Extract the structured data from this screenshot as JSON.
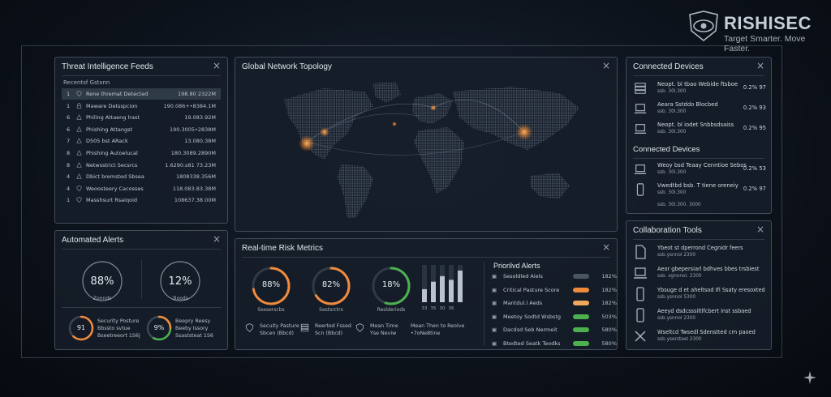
{
  "brand": {
    "name": "RISHISEC",
    "tagline": "Target Smarter. Move Faster."
  },
  "threat_feeds": {
    "title": "Threat Intelligence Feeds",
    "close": "×",
    "subtitle": "Recentsf Gstxnn",
    "rows": [
      {
        "num": "1",
        "icon": "shield-icon",
        "label": "Rene thremat Detected",
        "value": "198.80 2322M"
      },
      {
        "num": "1",
        "icon": "lock-icon",
        "label": "Maware Detsspcion",
        "value": "190.086+•8384.1M"
      },
      {
        "num": "6",
        "icon": "alert-icon",
        "label": "Philing Attaeng lrast",
        "value": "19.083.92M"
      },
      {
        "num": "6",
        "icon": "alert-icon",
        "label": "Phishing Attangst",
        "value": "190.3005•2838M"
      },
      {
        "num": "7",
        "icon": "alert-icon",
        "label": "D505 bst ARack",
        "value": "13.080.38M"
      },
      {
        "num": "8",
        "icon": "alert-icon",
        "label": "Phishing Autoelucal",
        "value": "180.3089.2890M"
      },
      {
        "num": "8",
        "icon": "alert-icon",
        "label": "Netwsstrict Secsrcs",
        "value": "1.6290.s81 73.23M"
      },
      {
        "num": "4",
        "icon": "alert-icon",
        "label": "Dbict bremsted Sbsea",
        "value": "1808338.356M"
      },
      {
        "num": "4",
        "icon": "shield-icon",
        "label": "Weoosteery Cacosses",
        "value": "118.083.83.38M"
      },
      {
        "num": "1",
        "icon": "shield-icon",
        "label": "Masshsurt Rsaiqoid",
        "value": "108637.38.00M"
      }
    ]
  },
  "network": {
    "title": "Global Network Topology",
    "close": "×"
  },
  "devices": {
    "title": "Connected Devices",
    "close": "×",
    "rows1": [
      {
        "icon": "server-icon",
        "line1": "Neopt. bl tbao Webide ftsboe",
        "line2": "ssb. 30l.300",
        "pct": "0.2% 97"
      },
      {
        "icon": "laptop-icon",
        "line1": "Aeara Sstddo Blocbed",
        "line2": "ssb. 30l.300",
        "pct": "0.2% 93"
      },
      {
        "icon": "laptop-icon",
        "line1": "Neopt. bl iodet Snbbsdsaiss",
        "line2": "ssb. 30l.300",
        "pct": "0.2% 95"
      }
    ],
    "title2": "Connected Devices",
    "rows2": [
      {
        "icon": "laptop-icon",
        "line1": "Weoy bsd Teaay Cenntioe Sebos",
        "line2": "ssb. 30l.300",
        "pct": "0.2% 53"
      },
      {
        "icon": "phone-icon",
        "line1": "Vwedtbd bsb. T tiene oreneiy",
        "line2": "ssb. 30l.300",
        "pct": "0.2% 97"
      }
    ],
    "footer": "ssb. 30l.300. 3000"
  },
  "auto_alerts": {
    "title": "Automated Alerts",
    "close": "×",
    "gauges": [
      {
        "value": "88%",
        "caption": "Zonnds",
        "pct": 0.88,
        "color": "#c9d1db"
      },
      {
        "value": "12%",
        "caption": "3loods",
        "pct": 0.12,
        "color": "#c9d1db"
      }
    ],
    "mini": [
      {
        "value": "91",
        "pct": 0.62,
        "color": "#f08a3c",
        "text": [
          "Security Posture",
          "Bbssto svtue",
          "Bseetreeort 1S6j"
        ]
      },
      {
        "value": "9%",
        "pct": 0.58,
        "color": "#4cb050",
        "color2": "#f08a3c",
        "text": [
          "Beepry Reesy",
          "Beeby Issory",
          "Ssaststeat 1S6"
        ]
      }
    ]
  },
  "risk": {
    "title": "Real-time Risk Metrics",
    "close": "×",
    "gauges": [
      {
        "value": "88%",
        "caption": "Sseserscbs",
        "pct": 0.72,
        "color": "#f08a3c"
      },
      {
        "value": "82%",
        "caption": "Sestsrctrs",
        "pct": 0.66,
        "color": "#f08a3c"
      },
      {
        "value": "18%",
        "caption": "Reslderiods",
        "pct": 0.55,
        "color": "#4cb050"
      }
    ],
    "bars": [
      0.35,
      0.55,
      0.7,
      0.6,
      0.85
    ],
    "bar_labels": [
      "33",
      "35",
      "30",
      "36",
      ""
    ],
    "metrics": [
      {
        "icon": "shield-icon",
        "lines": [
          "Secuity Pasture",
          "Sbcen (Bbcd)"
        ]
      },
      {
        "icon": "server-icon",
        "lines": [
          "Reerted Fssed",
          "Scn (Bbcd)"
        ]
      },
      {
        "icon": "shield-icon",
        "lines": [
          "Mean Time",
          "Yse Neviw"
        ]
      },
      {
        "icon": "",
        "lines": [
          "Mean Then to Reolve",
          "•7oNe8tine"
        ]
      }
    ]
  },
  "prio_alerts": {
    "title": "Priorilvd Alerts",
    "rows": [
      {
        "label": "Sesoldled Aiels",
        "color": "#4a5563",
        "value": "182%"
      },
      {
        "label": "Critical Pasture Score",
        "color": "#f08a3c",
        "value": "182%"
      },
      {
        "label": "Mantdul.l Aeds",
        "color": "#f0a85c",
        "value": "182%"
      },
      {
        "label": "Meetoy Sodtd Wsbstg",
        "color": "#4cb050",
        "value": "503%"
      },
      {
        "label": "Dacdsd Seb Nermeit",
        "color": "#4cb050",
        "value": "580%"
      },
      {
        "label": "Btedted Seatk Teodks",
        "color": "#4cb050",
        "value": "580%"
      }
    ]
  },
  "collab": {
    "title": "Collaboration Tools",
    "close": "×",
    "rows": [
      {
        "icon": "document-icon",
        "line1": "Ybeot st dperrond Cegnidr feers",
        "line2": "ssb.ysnnol 2300"
      },
      {
        "icon": "laptop-icon",
        "line1": "Aeor gbepersiarl bdhves bbes trsbiest",
        "line2": "ssb. sgnonol. 2300"
      },
      {
        "icon": "phone-icon",
        "line1": "Ybsuge d et aheltsod Ifi Ssaty eresoxted",
        "line2": "ssb.ysnnol 5300"
      },
      {
        "icon": "phone-icon",
        "line1": "Aeeyd dsdcsssiltlfcbert inst ssbaed",
        "line2": "ssb.ysnnol 2300"
      },
      {
        "icon": "tools-icon",
        "line1": "Wseltcd Twsedl Sdenstted crn paoed",
        "line2": "ssb.ysersteel 2300"
      }
    ]
  }
}
